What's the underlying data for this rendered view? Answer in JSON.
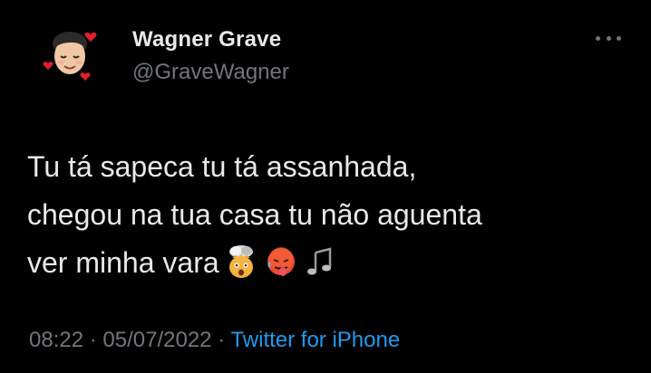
{
  "author": {
    "display_name": "Wagner Grave",
    "handle": "@GraveWagner",
    "avatar_icon": "memoji-face-with-hearts-icon"
  },
  "more_icon": "more-dots-icon",
  "tweet": {
    "lines": [
      "Tu tá sapeca tu tá assanhada,",
      "chegou na tua casa tu não aguenta",
      "ver minha vara"
    ],
    "emojis": [
      "exploding-head-emoji",
      "hot-face-emoji",
      "musical-notes-emoji"
    ]
  },
  "meta": {
    "time": "08:22",
    "separator": "·",
    "date": "05/07/2022",
    "source": "Twitter for iPhone"
  },
  "colors": {
    "background": "#000000",
    "text": "#e7e9ea",
    "secondary": "#71767b",
    "link": "#1d9bf0"
  }
}
